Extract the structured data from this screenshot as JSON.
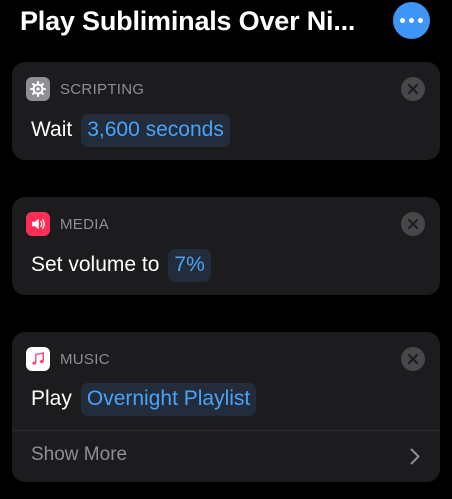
{
  "header": {
    "title": "Play Subliminals Over Ni...",
    "more_icon": "ellipsis-circle-icon"
  },
  "colors": {
    "accent": "#3d95f5",
    "token_text": "#4aa3f7",
    "card_bg": "#1c1c1e",
    "scripting_icon_bg": "#8e8e93",
    "media_icon_bg": "#fe2d55",
    "music_icon_bg": "#ffffff"
  },
  "actions": [
    {
      "app_label": "SCRIPTING",
      "icon": "gear-icon",
      "text": "Wait",
      "token": "3,600 seconds"
    },
    {
      "app_label": "MEDIA",
      "icon": "speaker-icon",
      "text": "Set volume to",
      "token": "7%"
    },
    {
      "app_label": "MUSIC",
      "icon": "music-note-icon",
      "text": "Play",
      "token": "Overnight Playlist",
      "show_more": "Show More"
    }
  ]
}
